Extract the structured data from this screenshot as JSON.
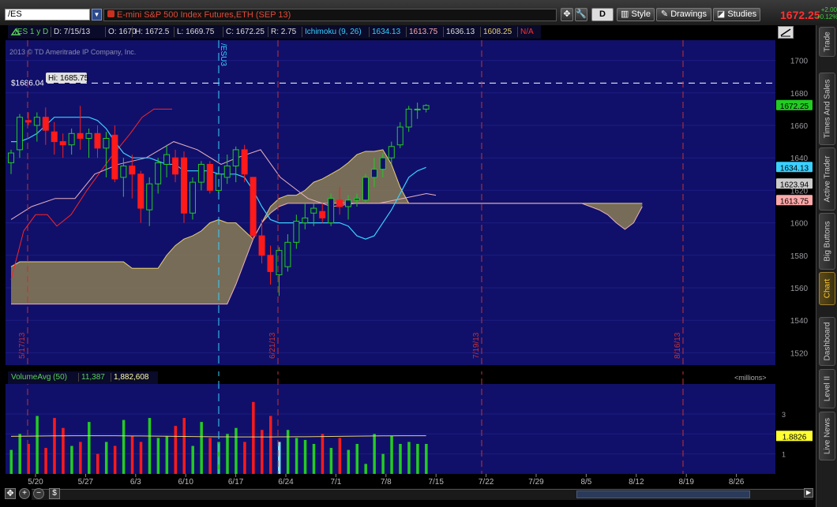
{
  "toolbar": {
    "symbol": "/ES",
    "instrument_title": "E-mini S&P 500 Index Futures,ETH (SEP 13)",
    "d_label": "D",
    "style_label": "Style",
    "drawings_label": "Drawings",
    "studies_label": "Studies",
    "last_price": "1672.25",
    "change_abs": "+2.00",
    "change_pct": "+0.12%"
  },
  "status": {
    "aggregation": "/ES 1 y D",
    "date": "D: 7/15/13",
    "open": "O: 1670",
    "high": "H: 1672.5",
    "low": "L: 1669.75",
    "close": "C: 1672.25",
    "range": "R: 2.75",
    "study": "Ichimoku (9, 26)",
    "v1": "1634.13",
    "v2": "1613.75",
    "v3": "1636.13",
    "v4": "1608.25",
    "v5": "N/A"
  },
  "copyright": "2013 © TD Ameritrade IP Company, Inc.",
  "sidebar_tabs": [
    "Trade",
    "Times And Sales",
    "Active Trader",
    "Big Buttons",
    "Chart",
    "Dashboard",
    "Level II",
    "Live News"
  ],
  "colors": {
    "plot_bg": "#10106a",
    "up_candle": "#22cc22",
    "down_candle": "#ff1a1a",
    "tenkan": "#3ad0ff",
    "kijun": "#ff2222",
    "chikou": "#e8b0c0",
    "cloud_bull": "#8a7d55",
    "cloud_bear": "#6a1a3a",
    "span_a": "#e8d070",
    "span_b": "#e8b0c0"
  },
  "chart_data": [
    {
      "type": "candlestick",
      "title": "",
      "ylim": [
        1510,
        1710
      ],
      "y_ticks": [
        1520,
        1540,
        1560,
        1580,
        1600,
        1620,
        1640,
        1660,
        1680,
        1700
      ],
      "high_marker": {
        "label": "Hi: 1685.75",
        "value": 1685.75,
        "line_label": "$1686.04",
        "line_value": 1686.04
      },
      "price_labels": [
        {
          "text": "1672.25",
          "value": 1672.25,
          "color": "#22cc22"
        },
        {
          "text": "1634.13",
          "value": 1634.13,
          "color": "#3ad0ff"
        },
        {
          "text": "1623.94",
          "value": 1623.94,
          "color": "#cccccc"
        },
        {
          "text": "1613.75",
          "value": 1613.75,
          "color": "#ffaaaa"
        }
      ],
      "expiration_label": "/ESU3",
      "period_labels": [
        "5/17/13",
        "6/21/13",
        "7/19/13",
        "8/16/13"
      ],
      "candles": [
        {
          "o": 1637,
          "h": 1645,
          "l": 1630,
          "c": 1643
        },
        {
          "o": 1645,
          "h": 1667,
          "l": 1640,
          "c": 1665
        },
        {
          "o": 1663,
          "h": 1668,
          "l": 1660,
          "c": 1662
        },
        {
          "o": 1660,
          "h": 1668,
          "l": 1650,
          "c": 1665
        },
        {
          "o": 1665,
          "h": 1671,
          "l": 1648,
          "c": 1657
        },
        {
          "o": 1656,
          "h": 1662,
          "l": 1642,
          "c": 1650
        },
        {
          "o": 1650,
          "h": 1655,
          "l": 1640,
          "c": 1648
        },
        {
          "o": 1648,
          "h": 1658,
          "l": 1642,
          "c": 1655
        },
        {
          "o": 1655,
          "h": 1672,
          "l": 1645,
          "c": 1652
        },
        {
          "o": 1652,
          "h": 1658,
          "l": 1640,
          "c": 1655
        },
        {
          "o": 1655,
          "h": 1660,
          "l": 1640,
          "c": 1646
        },
        {
          "o": 1646,
          "h": 1656,
          "l": 1628,
          "c": 1652
        },
        {
          "o": 1654,
          "h": 1660,
          "l": 1625,
          "c": 1627
        },
        {
          "o": 1628,
          "h": 1640,
          "l": 1616,
          "c": 1635
        },
        {
          "o": 1635,
          "h": 1642,
          "l": 1615,
          "c": 1630
        },
        {
          "o": 1630,
          "h": 1632,
          "l": 1600,
          "c": 1609
        },
        {
          "o": 1608,
          "h": 1628,
          "l": 1598,
          "c": 1624
        },
        {
          "o": 1624,
          "h": 1640,
          "l": 1618,
          "c": 1637
        },
        {
          "o": 1636,
          "h": 1648,
          "l": 1628,
          "c": 1642
        },
        {
          "o": 1640,
          "h": 1645,
          "l": 1625,
          "c": 1630
        },
        {
          "o": 1640,
          "h": 1644,
          "l": 1600,
          "c": 1606
        },
        {
          "o": 1606,
          "h": 1628,
          "l": 1602,
          "c": 1625
        },
        {
          "o": 1625,
          "h": 1638,
          "l": 1620,
          "c": 1636
        },
        {
          "o": 1636,
          "h": 1638,
          "l": 1618,
          "c": 1620
        },
        {
          "o": 1620,
          "h": 1634,
          "l": 1618,
          "c": 1630
        },
        {
          "o": 1628,
          "h": 1642,
          "l": 1624,
          "c": 1635
        },
        {
          "o": 1635,
          "h": 1647,
          "l": 1625,
          "c": 1645
        },
        {
          "o": 1645,
          "h": 1648,
          "l": 1625,
          "c": 1630
        },
        {
          "o": 1628,
          "h": 1622,
          "l": 1590,
          "c": 1592
        },
        {
          "o": 1592,
          "h": 1602,
          "l": 1575,
          "c": 1580
        },
        {
          "o": 1580,
          "h": 1586,
          "l": 1562,
          "c": 1570
        },
        {
          "o": 1568,
          "h": 1585,
          "l": 1555,
          "c": 1583
        },
        {
          "o": 1573,
          "h": 1593,
          "l": 1570,
          "c": 1588
        },
        {
          "o": 1588,
          "h": 1605,
          "l": 1584,
          "c": 1601
        },
        {
          "o": 1600,
          "h": 1612,
          "l": 1596,
          "c": 1603
        },
        {
          "o": 1606,
          "h": 1612,
          "l": 1598,
          "c": 1609
        },
        {
          "o": 1607,
          "h": 1612,
          "l": 1600,
          "c": 1603
        },
        {
          "o": 1600,
          "h": 1618,
          "l": 1598,
          "c": 1615
        },
        {
          "o": 1614,
          "h": 1622,
          "l": 1605,
          "c": 1610
        },
        {
          "o": 1610,
          "h": 1617,
          "l": 1602,
          "c": 1614
        },
        {
          "o": 1614,
          "h": 1618,
          "l": 1610,
          "c": 1615
        },
        {
          "o": 1614,
          "h": 1630,
          "l": 1612,
          "c": 1628
        },
        {
          "o": 1628,
          "h": 1640,
          "l": 1622,
          "c": 1633
        },
        {
          "o": 1633,
          "h": 1643,
          "l": 1628,
          "c": 1640
        },
        {
          "o": 1640,
          "h": 1650,
          "l": 1636,
          "c": 1647
        },
        {
          "o": 1648,
          "h": 1662,
          "l": 1646,
          "c": 1659
        },
        {
          "o": 1659,
          "h": 1672,
          "l": 1656,
          "c": 1670
        },
        {
          "o": 1670,
          "h": 1674,
          "l": 1664,
          "c": 1670
        },
        {
          "o": 1670,
          "h": 1673,
          "l": 1668,
          "c": 1672.25
        }
      ],
      "tenkan": [
        1650,
        1650,
        1652,
        1655,
        1660,
        1665,
        1665,
        1665,
        1665,
        1665,
        1663,
        1658,
        1650,
        1643,
        1640,
        1640,
        1640,
        1638,
        1636,
        1636,
        1632,
        1632,
        1632,
        1632,
        1630,
        1630,
        1630,
        1628,
        1620,
        1610,
        1602,
        1600,
        1600,
        1600,
        1600,
        1600,
        1600,
        1600,
        1600,
        1598,
        1592,
        1590,
        1592,
        1600,
        1608,
        1618,
        1628,
        1632,
        1634.13
      ],
      "kijun_dates": [
        0,
        1,
        2,
        3,
        4,
        5,
        6,
        7,
        8,
        9,
        10,
        11
      ],
      "kijun_sample": [
        1580,
        1590,
        1600,
        1618,
        1640,
        1660,
        1665,
        1670,
        1672,
        1674,
        1674,
        1674
      ],
      "span_a": [
        1573,
        1576,
        1576,
        1576,
        1576,
        1576,
        1576,
        1576,
        1576,
        1576,
        1576,
        1576,
        1576,
        1576,
        1572,
        1572,
        1572,
        1572,
        1580,
        1586,
        1590,
        1592,
        1595,
        1600,
        1602,
        1600,
        1600,
        1595,
        1590,
        1600,
        1610,
        1615,
        1617,
        1617,
        1620,
        1625,
        1627,
        1630,
        1633,
        1637,
        1642,
        1644,
        1644,
        1645,
        1636,
        1622,
        1612,
        1612,
        1612,
        1612,
        1612,
        1612,
        1612,
        1612,
        1612,
        1612,
        1612,
        1612,
        1612,
        1612,
        1612,
        1612,
        1612,
        1612,
        1612,
        1612,
        1612,
        1612,
        1612,
        1612,
        1612,
        1612,
        1612,
        1612
      ],
      "span_b": [
        1550,
        1550,
        1550,
        1550,
        1550,
        1550,
        1550,
        1550,
        1550,
        1550,
        1550,
        1550,
        1550,
        1550,
        1550,
        1550,
        1550,
        1550,
        1550,
        1550,
        1550,
        1550,
        1550,
        1550,
        1550,
        1550,
        1562,
        1576,
        1590,
        1600,
        1606,
        1610,
        1612,
        1612,
        1612,
        1612,
        1612,
        1612,
        1612,
        1612,
        1612,
        1612,
        1612,
        1612,
        1612,
        1612,
        1612,
        1612,
        1612,
        1612,
        1612,
        1612,
        1612,
        1612,
        1612,
        1612,
        1612,
        1612,
        1612,
        1612,
        1612,
        1612,
        1612,
        1612,
        1612,
        1612,
        1612,
        1610,
        1608,
        1605,
        1600,
        1596,
        1600,
        1610
      ]
    },
    {
      "type": "bar",
      "title": "VolumeAvg (50)",
      "readouts": [
        "11,387",
        "1,882,608"
      ],
      "unit_label": "<millions>",
      "ylim": [
        0,
        4.5
      ],
      "y_ticks": [
        1,
        2,
        3
      ],
      "avg_label": "1.8826",
      "avg_value": 1.8826,
      "volumes": [
        1.2,
        2.0,
        1.5,
        2.9,
        1.3,
        2.8,
        2.3,
        1.4,
        1.6,
        2.6,
        1.0,
        1.6,
        1.4,
        2.7,
        1.9,
        1.6,
        2.8,
        1.8,
        1.9,
        2.4,
        2.8,
        1.4,
        2.6,
        1.8,
        1.6,
        2.0,
        2.3,
        1.6,
        3.6,
        2.2,
        2.9,
        1.6,
        2.2,
        1.8,
        1.7,
        1.5,
        2.0,
        1.3,
        1.8,
        1.2,
        1.5,
        0.5,
        2.0,
        1.0,
        1.9,
        1.5,
        1.6,
        1.5,
        1.5
      ],
      "x_tick_labels": [
        "5/20",
        "5/27",
        "6/3",
        "6/10",
        "6/17",
        "6/24",
        "7/1",
        "7/8",
        "7/15",
        "7/22",
        "7/29",
        "8/5",
        "8/12",
        "8/19",
        "8/26"
      ]
    }
  ]
}
